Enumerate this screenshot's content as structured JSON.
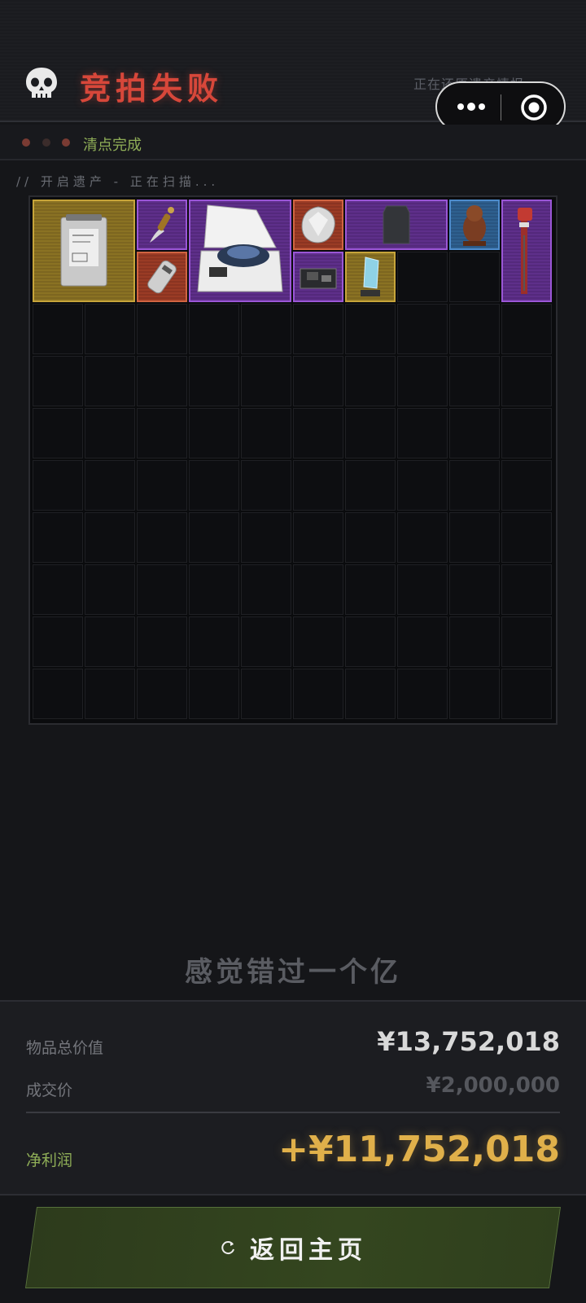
{
  "header": {
    "title": "竞拍失败",
    "restore_text": "正在还原遗产情报. . .",
    "status_text": "清点完成",
    "scan_text": "// 开启遗产 - 正在扫描..."
  },
  "colors": {
    "accent_red": "#d7473a",
    "accent_green": "#8fae57",
    "profit_gold": "#e0b04a",
    "rarity_gold": "#c6a43a",
    "rarity_purple": "#9a56d6",
    "rarity_red": "#d06441",
    "rarity_blue": "#4e8ccc"
  },
  "inventory": {
    "columns": 10,
    "rows": 10,
    "items": [
      {
        "name": "document-bag",
        "rarity": "gold"
      },
      {
        "name": "dagger",
        "rarity": "purple"
      },
      {
        "name": "centrifuge",
        "rarity": "purple"
      },
      {
        "name": "diamond",
        "rarity": "red"
      },
      {
        "name": "armor-plate",
        "rarity": "purple"
      },
      {
        "name": "owl-statue",
        "rarity": "blue"
      },
      {
        "name": "pipe-wrench",
        "rarity": "purple"
      },
      {
        "name": "flashlight",
        "rarity": "red"
      },
      {
        "name": "circuit-board",
        "rarity": "purple"
      },
      {
        "name": "crystal-trophy",
        "rarity": "gold"
      }
    ]
  },
  "summary": {
    "missed_text": "感觉错过一个亿",
    "total_label": "物品总价值",
    "total_value": "¥13,752,018",
    "price_label": "成交价",
    "price_value": "¥2,000,000",
    "profit_label": "净利润",
    "profit_value": "+¥11,752,018"
  },
  "footer": {
    "back_label": "返回主页"
  }
}
